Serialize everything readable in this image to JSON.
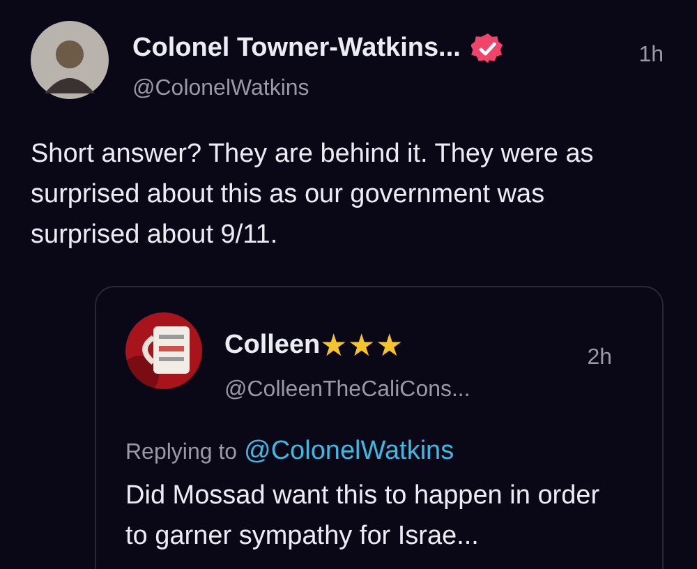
{
  "post": {
    "author": {
      "name": "Colonel Towner-Watkins...",
      "verified": true,
      "handle": "@ColonelWatkins"
    },
    "time": "1h",
    "text": "Short answer? They are behind it. They were as surprised about this as our government was surprised about 9/11."
  },
  "quoted_post": {
    "author": {
      "name": "Colleen",
      "name_emoji": "★★★",
      "handle": "@ColleenTheCaliCons..."
    },
    "time": "2h",
    "replying_label": "Replying to",
    "replying_to": "@ColonelWatkins",
    "text": "Did Mossad want this to happen in order to garner sympathy for Israe..."
  }
}
